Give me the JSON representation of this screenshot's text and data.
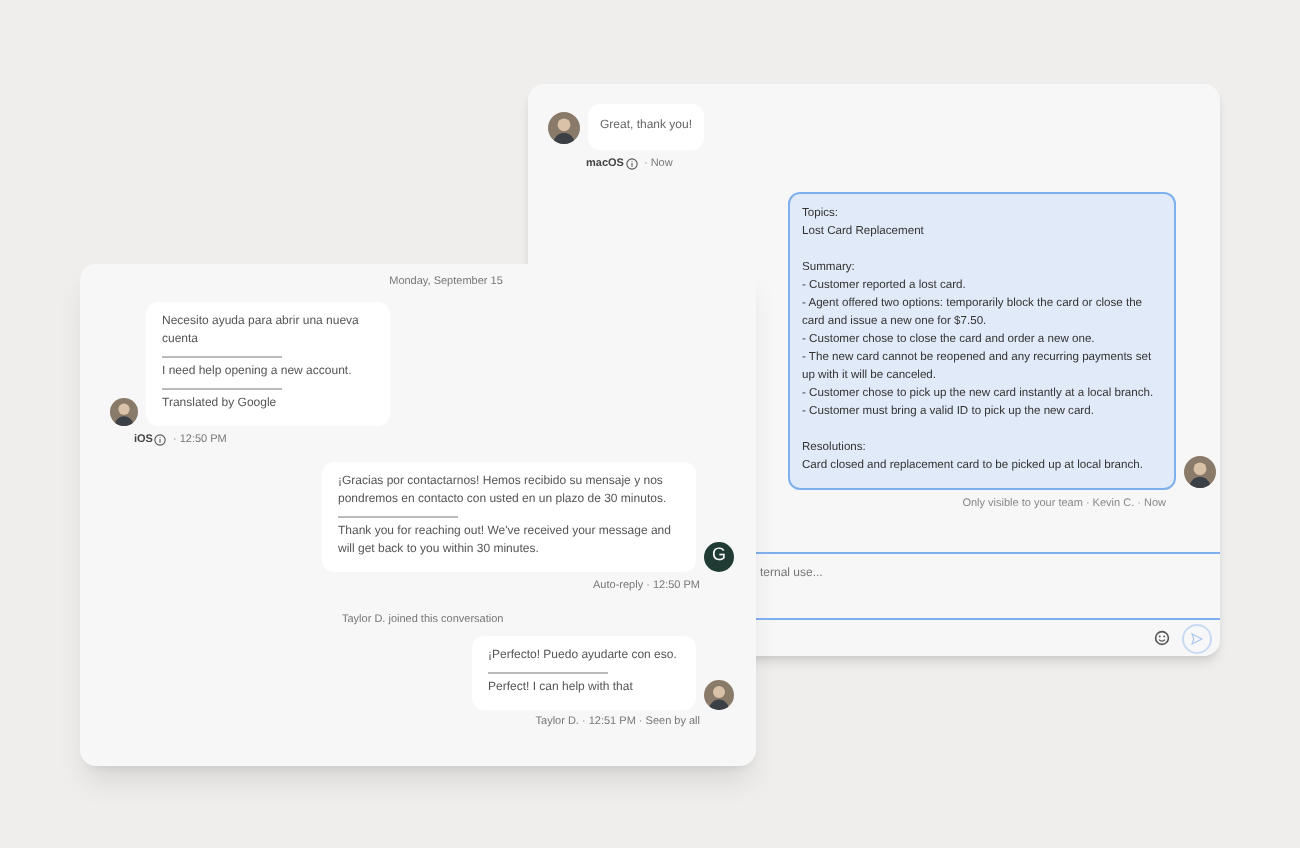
{
  "back_window": {
    "message": {
      "text": "Great, thank you!",
      "platform": "macOS",
      "time": "· Now"
    },
    "internal_note": {
      "sections": [
        {
          "heading": "Topics:",
          "lines": [
            "Lost Card Replacement"
          ]
        },
        {
          "heading": "Summary:",
          "lines": [
            "- Customer reported a lost card.",
            "- Agent offered two options: temporarily block the card or close the card and issue a new one for $7.50.",
            "- Customer chose to close the card and order a new one.",
            "- The new card cannot be reopened and any recurring payments set up with it will be canceled.",
            "- Customer chose to pick up the new card instantly at a local branch.",
            "- Customer must bring a valid ID to pick up the new card."
          ]
        },
        {
          "heading": "Resolutions:",
          "lines": [
            "Card closed and replacement card to be picked up at local branch."
          ]
        }
      ],
      "footer": "Only visible to your team · Kevin C. · Now"
    },
    "composer": {
      "placeholder": "ternal use..."
    }
  },
  "front_window": {
    "date": "Monday, September 15",
    "messages": [
      {
        "kind": "customer",
        "original": "Necesito ayuda para abrir una nueva cuenta",
        "translation": "I need help opening a new account.",
        "note": "Translated by Google",
        "platform": "iOS",
        "time": "· 12:50 PM"
      },
      {
        "kind": "auto_reply",
        "original": "¡Gracias por contactarnos! Hemos recibido su mensaje y nos pondremos en contacto con usted en un plazo de 30 minutos.",
        "translation": "Thank you for reaching out! We've received your message and will get back to you within 30 minutes.",
        "avatar_letter": "G",
        "meta": "Auto-reply · 12:50 PM"
      },
      {
        "kind": "event",
        "text": "Taylor D. joined this conversation"
      },
      {
        "kind": "agent",
        "original": "¡Perfecto! Puedo ayudarte con eso.",
        "translation": "Perfect! I can help with that",
        "meta": "Taylor D. · 12:51 PM · Seen by all"
      }
    ]
  }
}
